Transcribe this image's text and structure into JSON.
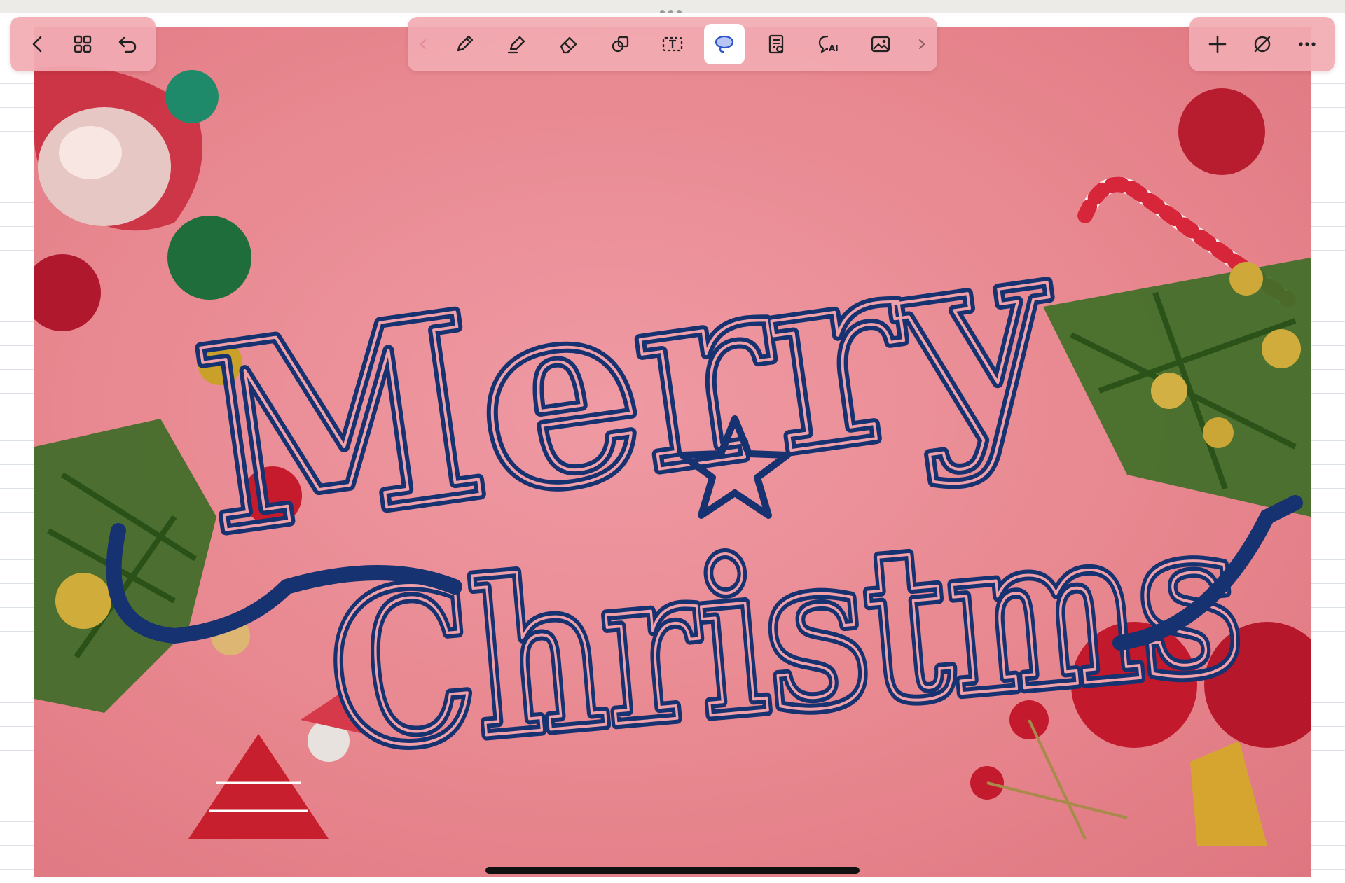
{
  "app": {
    "name": "Notes canvas"
  },
  "toolbar_left": {
    "items": [
      {
        "icon": "chevron-left-icon",
        "name": "back-button"
      },
      {
        "icon": "grid-icon",
        "name": "pages-overview-button"
      },
      {
        "icon": "undo-icon",
        "name": "undo-button"
      }
    ]
  },
  "toolbar_center": {
    "items": [
      {
        "icon": "chevron-left-icon",
        "name": "tools-scroll-left-button"
      },
      {
        "icon": "pencil-icon",
        "name": "pen-tool-button"
      },
      {
        "icon": "highlighter-icon",
        "name": "highlighter-tool-button"
      },
      {
        "icon": "eraser-icon",
        "name": "eraser-tool-button"
      },
      {
        "icon": "shapes-icon",
        "name": "shape-tool-button"
      },
      {
        "icon": "text-box-icon",
        "name": "text-tool-button"
      },
      {
        "icon": "lasso-icon",
        "name": "lasso-tool-button",
        "active": true
      },
      {
        "icon": "document-icon",
        "name": "sticker-tool-button"
      },
      {
        "icon": "ai-chat-icon",
        "name": "ai-assistant-button",
        "label": "AI"
      },
      {
        "icon": "image-icon",
        "name": "image-tool-button"
      },
      {
        "icon": "chevron-right-icon",
        "name": "tools-scroll-right-button"
      }
    ]
  },
  "toolbar_right": {
    "items": [
      {
        "icon": "plus-icon",
        "name": "add-page-button"
      },
      {
        "icon": "no-entry-icon",
        "name": "hide-toolbar-button"
      },
      {
        "icon": "more-icon",
        "name": "more-options-button"
      }
    ]
  },
  "canvas": {
    "handwritten_text": [
      "Merry",
      "Christms"
    ],
    "ink_color": "#163270",
    "background_color": "#e8878f",
    "accent_colors": {
      "toolbar": "#f2aab2",
      "active_tool": "#ffffff",
      "lasso": "#5b7fe0"
    }
  }
}
